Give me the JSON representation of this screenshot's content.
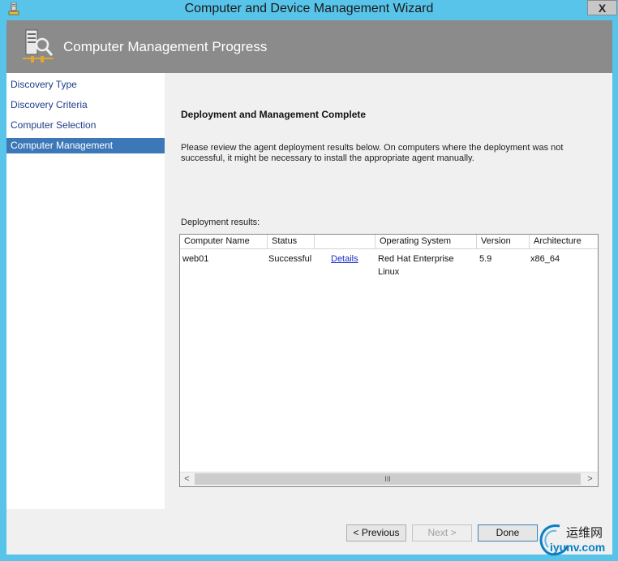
{
  "window": {
    "title": "Computer and Device Management Wizard",
    "close_label": "X"
  },
  "header": {
    "title": "Computer Management Progress",
    "icon": "computer-search-icon"
  },
  "nav": {
    "items": [
      {
        "label": "Discovery Type",
        "active": false
      },
      {
        "label": "Discovery Criteria",
        "active": false
      },
      {
        "label": "Computer Selection",
        "active": false
      },
      {
        "label": "Computer Management",
        "active": true
      }
    ]
  },
  "main": {
    "heading": "Deployment and Management Complete",
    "description": "Please review the agent deployment results below. On computers where the deployment was not successful, it might be necessary to install the appropriate agent manually.",
    "results_label": "Deployment results:"
  },
  "table": {
    "columns": [
      "Computer Name",
      "Status",
      "",
      "Operating System",
      "Version",
      "Architecture"
    ],
    "rows": [
      {
        "computer_name": "web01",
        "status": "Successful",
        "details": "Details",
        "os": "Red Hat Enterprise Linux",
        "version": "5.9",
        "architecture": "x86_64"
      }
    ],
    "scroll_left": "<",
    "scroll_right": ">",
    "scroll_grip": "III"
  },
  "footer": {
    "previous_label": "< Previous",
    "next_label": "Next >",
    "done_label": "Done"
  },
  "watermark": {
    "top_text": "运维网",
    "bottom_text": "iyunv.com"
  },
  "colors": {
    "window_frame": "#58c4ea",
    "header_band": "#8b8b8b",
    "nav_selected": "#3c78b8",
    "link": "#1a2ec4"
  }
}
